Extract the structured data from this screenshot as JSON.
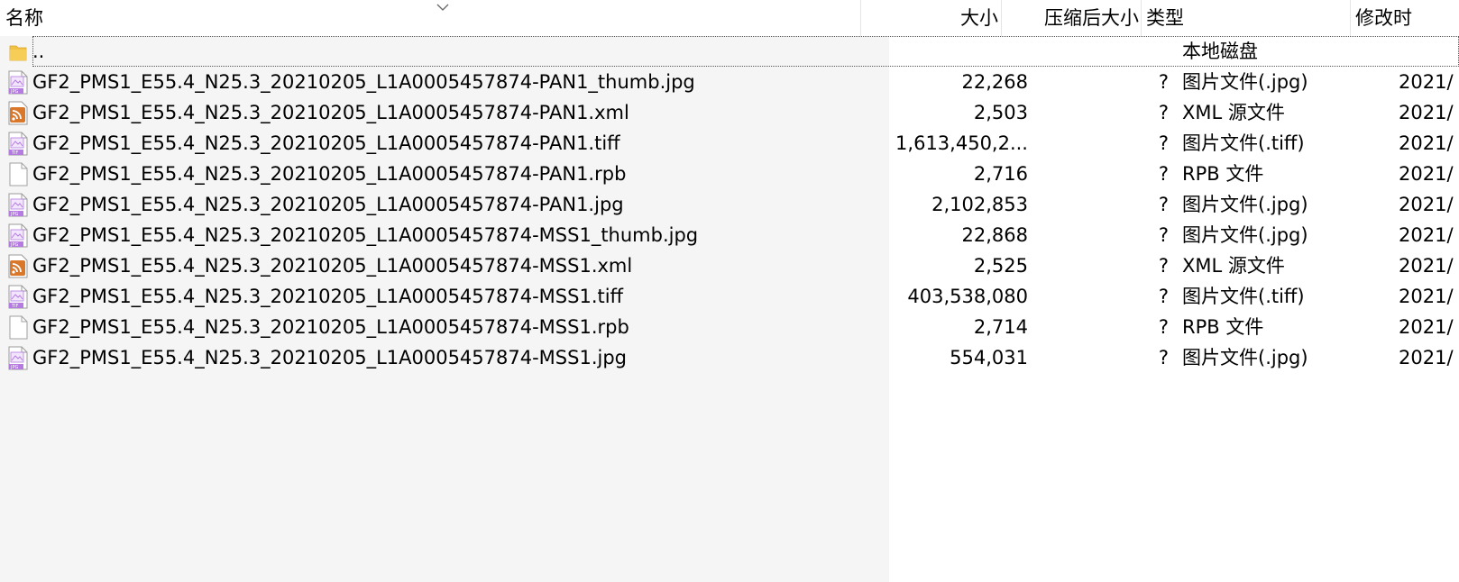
{
  "columns": {
    "name": "名称",
    "size": "大小",
    "compressed": "压缩后大小",
    "type": "类型",
    "modified": "修改时"
  },
  "parent": {
    "name": "..",
    "type": "本地磁盘",
    "icon": "folder-icon"
  },
  "files": [
    {
      "name": "GF2_PMS1_E55.4_N25.3_20210205_L1A0005457874-PAN1_thumb.jpg",
      "size": "22,268",
      "compressed": "?",
      "type": "图片文件(.jpg)",
      "modified": "2021/",
      "icon": "jpg-image-icon"
    },
    {
      "name": "GF2_PMS1_E55.4_N25.3_20210205_L1A0005457874-PAN1.xml",
      "size": "2,503",
      "compressed": "?",
      "type": "XML 源文件",
      "modified": "2021/",
      "icon": "xml-rss-icon"
    },
    {
      "name": "GF2_PMS1_E55.4_N25.3_20210205_L1A0005457874-PAN1.tiff",
      "size": "1,613,450,2...",
      "compressed": "?",
      "type": "图片文件(.tiff)",
      "modified": "2021/",
      "icon": "tif-image-icon"
    },
    {
      "name": "GF2_PMS1_E55.4_N25.3_20210205_L1A0005457874-PAN1.rpb",
      "size": "2,716",
      "compressed": "?",
      "type": "RPB 文件",
      "modified": "2021/",
      "icon": "blank-file-icon"
    },
    {
      "name": "GF2_PMS1_E55.4_N25.3_20210205_L1A0005457874-PAN1.jpg",
      "size": "2,102,853",
      "compressed": "?",
      "type": "图片文件(.jpg)",
      "modified": "2021/",
      "icon": "jpg-image-icon"
    },
    {
      "name": "GF2_PMS1_E55.4_N25.3_20210205_L1A0005457874-MSS1_thumb.jpg",
      "size": "22,868",
      "compressed": "?",
      "type": "图片文件(.jpg)",
      "modified": "2021/",
      "icon": "jpg-image-icon"
    },
    {
      "name": "GF2_PMS1_E55.4_N25.3_20210205_L1A0005457874-MSS1.xml",
      "size": "2,525",
      "compressed": "?",
      "type": "XML 源文件",
      "modified": "2021/",
      "icon": "xml-rss-icon"
    },
    {
      "name": "GF2_PMS1_E55.4_N25.3_20210205_L1A0005457874-MSS1.tiff",
      "size": "403,538,080",
      "compressed": "?",
      "type": "图片文件(.tiff)",
      "modified": "2021/",
      "icon": "tif-image-icon"
    },
    {
      "name": "GF2_PMS1_E55.4_N25.3_20210205_L1A0005457874-MSS1.rpb",
      "size": "2,714",
      "compressed": "?",
      "type": "RPB 文件",
      "modified": "2021/",
      "icon": "blank-file-icon"
    },
    {
      "name": "GF2_PMS1_E55.4_N25.3_20210205_L1A0005457874-MSS1.jpg",
      "size": "554,031",
      "compressed": "?",
      "type": "图片文件(.jpg)",
      "modified": "2021/",
      "icon": "jpg-image-icon"
    }
  ],
  "colors": {
    "name_column_bg": "#f5f5f5",
    "image_icon": "#b57be0",
    "xml_icon": "#d9782b",
    "folder_icon": "#f3c244"
  }
}
